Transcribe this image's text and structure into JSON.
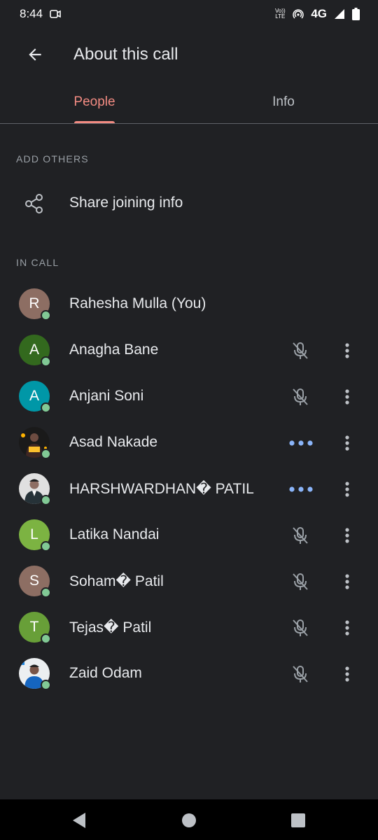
{
  "status_bar": {
    "time": "8:44",
    "network": "4G",
    "volte": "Vo)) LTE",
    "icons": [
      "screen-record-icon",
      "volte-icon",
      "hotspot-icon",
      "signal-icon",
      "battery-icon"
    ]
  },
  "header": {
    "title": "About this call",
    "back_icon": "arrow-left-icon"
  },
  "tabs": [
    {
      "label": "People",
      "active": true
    },
    {
      "label": "Info",
      "active": false
    }
  ],
  "add_others": {
    "section_label": "ADD OTHERS",
    "share_label": "Share joining info",
    "share_icon": "share-icon"
  },
  "in_call": {
    "section_label": "IN CALL",
    "participants": [
      {
        "name": "Rahesha Mulla (You)",
        "initial": "R",
        "avatar_color": "#8d6e63",
        "status": "none"
      },
      {
        "name": "Anagha Bane",
        "initial": "A",
        "avatar_color": "#33691e",
        "status": "muted"
      },
      {
        "name": "Anjani Soni",
        "initial": "A",
        "avatar_color": "#0097a7",
        "status": "muted"
      },
      {
        "name": "Asad Nakade",
        "initial": "",
        "avatar_color": "#1a1a1a",
        "status": "speaking"
      },
      {
        "name": "HARSHWARDHAN� PATIL",
        "initial": "",
        "avatar_color": "#e0e0e0",
        "status": "speaking"
      },
      {
        "name": "Latika Nandai",
        "initial": "L",
        "avatar_color": "#7cb342",
        "status": "muted"
      },
      {
        "name": "Soham� Patil",
        "initial": "S",
        "avatar_color": "#8d6e63",
        "status": "muted"
      },
      {
        "name": "Tejas� Patil",
        "initial": "T",
        "avatar_color": "#689f38",
        "status": "muted"
      },
      {
        "name": "Zaid Odam",
        "initial": "",
        "avatar_color": "#eceff1",
        "status": "muted"
      }
    ]
  },
  "colors": {
    "background": "#202124",
    "accent": "#f28b82",
    "online": "#81c995",
    "speaking": "#8ab4f8",
    "muted_icon": "#9aa0a6"
  },
  "nav_bar": {
    "icons": [
      "back-triangle-icon",
      "home-circle-icon",
      "recents-square-icon"
    ]
  }
}
